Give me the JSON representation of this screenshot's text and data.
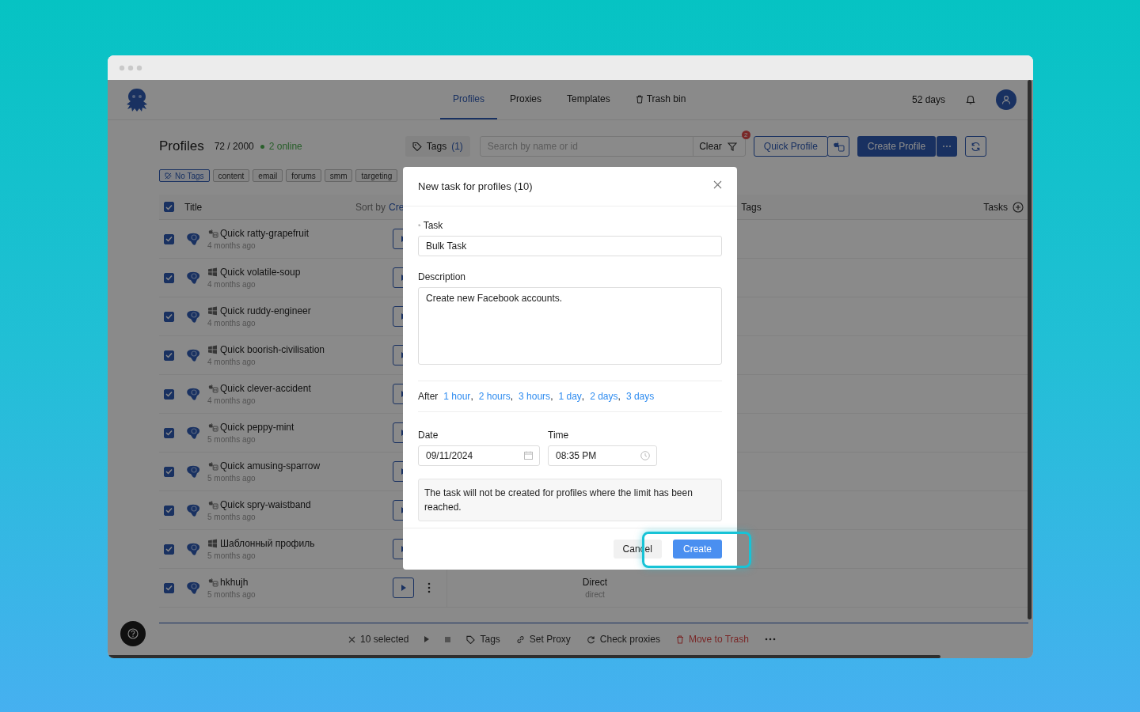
{
  "nav": {
    "tabs": [
      {
        "label": "Profiles",
        "selected": true,
        "kind": "text"
      },
      {
        "label": "Proxies",
        "selected": false,
        "kind": "text"
      },
      {
        "label": "Templates",
        "selected": false,
        "kind": "text"
      },
      {
        "label": "Trash bin",
        "selected": false,
        "kind": "trash"
      }
    ],
    "days": "52 days"
  },
  "toolbar": {
    "title": "Profiles",
    "count": "72 / 2000",
    "online": "2 online",
    "tags_label": "Tags",
    "tags_count": "(1)",
    "search": {
      "placeholder": "Search by name or id"
    },
    "clear": "Clear",
    "filter_badge": "2",
    "quick_profile": "Quick Profile",
    "create_profile": "Create Profile"
  },
  "tag_filters": [
    {
      "label": "No Tags",
      "selected": true
    },
    {
      "label": "content",
      "selected": false
    },
    {
      "label": "email",
      "selected": false
    },
    {
      "label": "forums",
      "selected": false
    },
    {
      "label": "smm",
      "selected": false
    },
    {
      "label": "targeting",
      "selected": false
    }
  ],
  "table": {
    "all_checked": true,
    "title_header": "Title",
    "sort_label": "Sort by",
    "sort_value": "Cre",
    "tags_header": "Tags",
    "tasks_header": "Tasks",
    "rows": [
      {
        "name": "Quick ratty-grapefruit",
        "time": "4 months ago",
        "kind": "mac",
        "checked": true
      },
      {
        "name": "Quick volatile-soup",
        "time": "4 months ago",
        "kind": "windows",
        "checked": true
      },
      {
        "name": "Quick ruddy-engineer",
        "time": "4 months ago",
        "kind": "windows",
        "checked": true
      },
      {
        "name": "Quick boorish-civilisation",
        "time": "4 months ago",
        "kind": "windows",
        "checked": true
      },
      {
        "name": "Quick clever-accident",
        "time": "4 months ago",
        "kind": "mac",
        "checked": true
      },
      {
        "name": "Quick peppy-mint",
        "time": "5 months ago",
        "kind": "mac",
        "checked": true
      },
      {
        "name": "Quick amusing-sparrow",
        "time": "5 months ago",
        "kind": "mac",
        "checked": true
      },
      {
        "name": "Quick spry-waistband",
        "time": "5 months ago",
        "kind": "mac",
        "checked": true
      },
      {
        "name": "Шаблонный профиль",
        "time": "5 months ago",
        "kind": "windows",
        "checked": true
      },
      {
        "name": "hkhujh",
        "time": "5 months ago",
        "kind": "mac",
        "checked": true,
        "proxy": "Direct",
        "proxy_type": "direct"
      }
    ]
  },
  "bulk_bar": {
    "selected": "10 selected",
    "actions": [
      {
        "label": "Tags",
        "kind": "tag",
        "danger": false
      },
      {
        "label": "Set Proxy",
        "kind": "link",
        "danger": false
      },
      {
        "label": "Check proxies",
        "kind": "refresh",
        "danger": false
      },
      {
        "label": "Move to Trash",
        "kind": "trash",
        "danger": true
      }
    ]
  },
  "dialog": {
    "title": "New task for profiles (10)",
    "required_mark": "*",
    "task_label": "Task",
    "task_value": "Bulk Task",
    "description_label": "Description",
    "description_value": "Create new Facebook accounts.",
    "after_label": "After",
    "after_separator": ",",
    "after_options": [
      "1 hour",
      "2 hours",
      "3 hours",
      "1 day",
      "2 days",
      "3 days"
    ],
    "date_label": "Date",
    "date_value": "09/11/2024",
    "time_label": "Time",
    "time_value": "08:35 PM",
    "note": "The task will not be created for profiles where the limit has been reached.",
    "cancel": "Cancel",
    "create": "Create",
    "create_highlighted": true
  }
}
